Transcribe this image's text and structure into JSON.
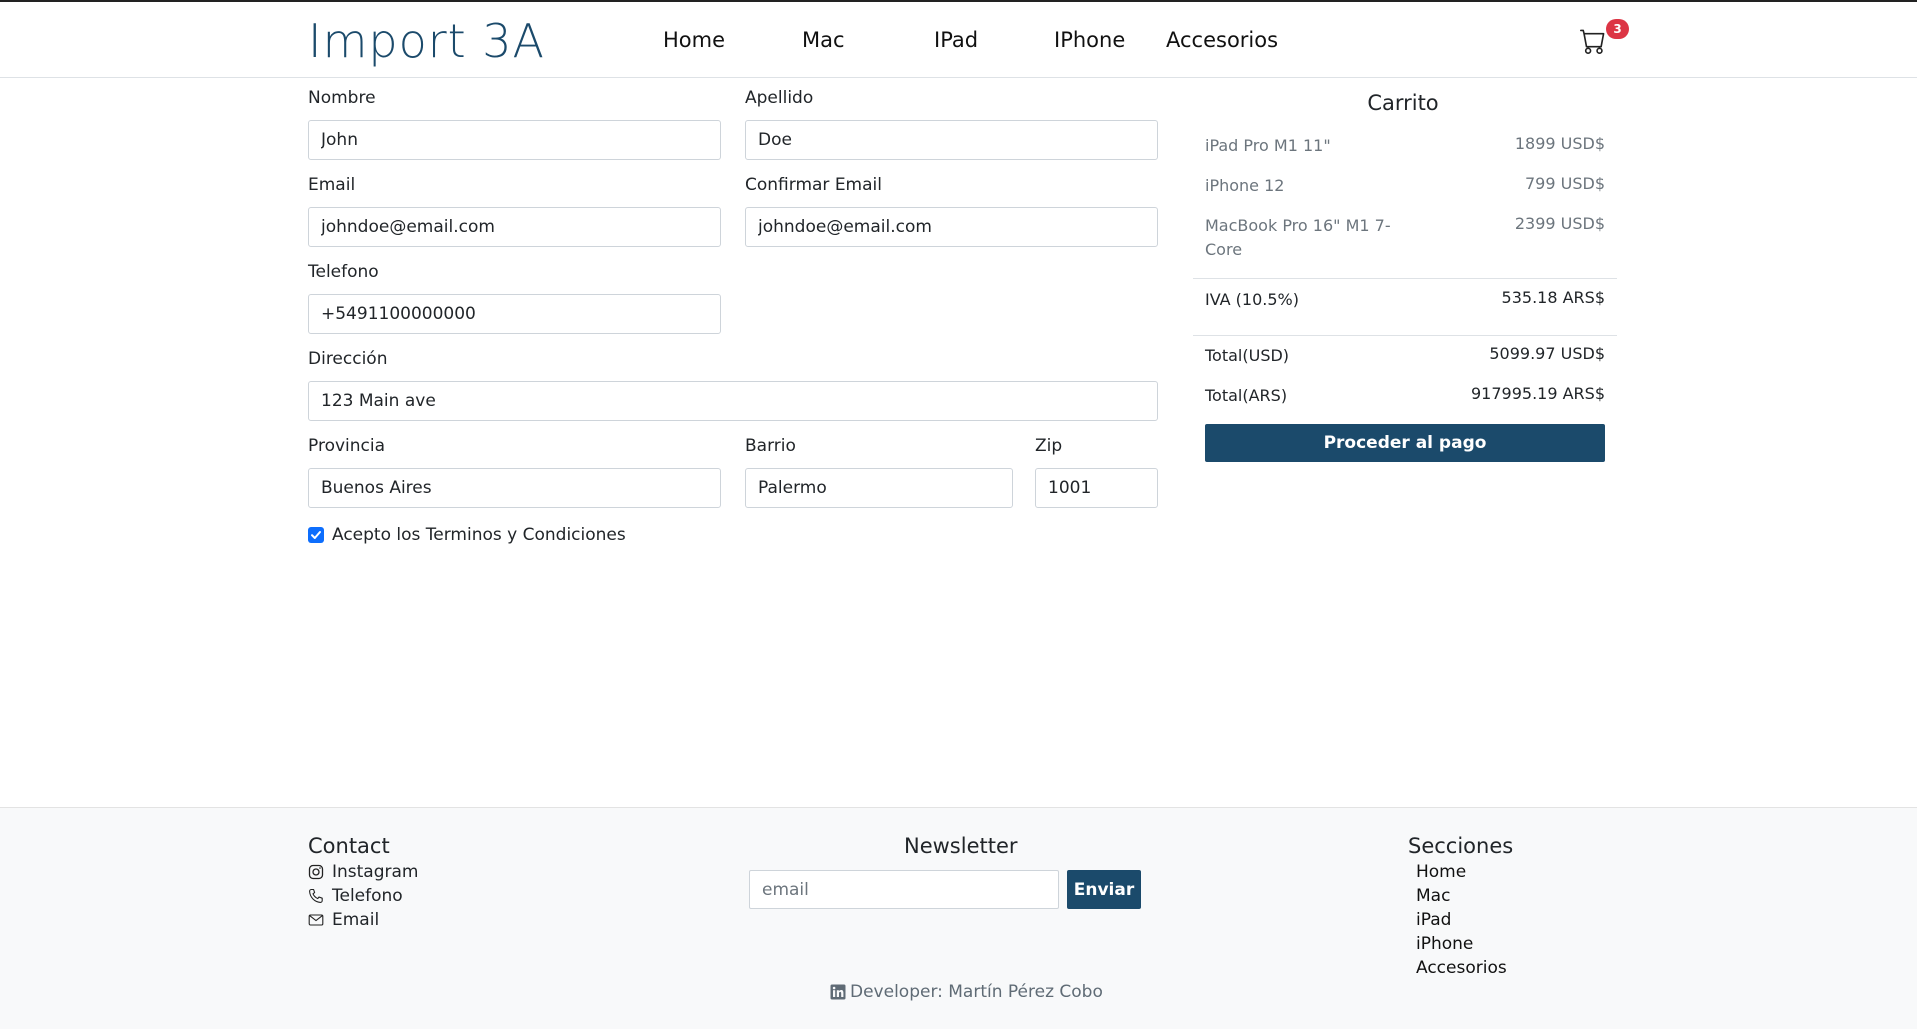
{
  "brand": {
    "logo": "Import 3A"
  },
  "nav": {
    "items": [
      "Home",
      "Mac",
      "IPad",
      "IPhone",
      "Accesorios"
    ],
    "cart_count": "3"
  },
  "form": {
    "nombre": {
      "label": "Nombre",
      "value": "John"
    },
    "apellido": {
      "label": "Apellido",
      "value": "Doe"
    },
    "email": {
      "label": "Email",
      "value": "johndoe@email.com"
    },
    "confirm_email": {
      "label": "Confirmar Email",
      "value": "johndoe@email.com"
    },
    "telefono": {
      "label": "Telefono",
      "value": "+5491100000000"
    },
    "direccion": {
      "label": "Dirección",
      "value": "123 Main ave"
    },
    "provincia": {
      "label": "Provincia",
      "value": "Buenos Aires"
    },
    "barrio": {
      "label": "Barrio",
      "value": "Palermo"
    },
    "zip": {
      "label": "Zip",
      "value": "1001"
    },
    "terms": {
      "label": "Acepto los Terminos y Condiciones",
      "checked": true
    }
  },
  "cart": {
    "title": "Carrito",
    "items": [
      {
        "name": "iPad Pro M1 11\"",
        "price": "1899 USD$"
      },
      {
        "name": "iPhone 12",
        "price": "799 USD$"
      },
      {
        "name": "MacBook Pro 16\" M1 7-Core",
        "price": "2399 USD$"
      }
    ],
    "iva": {
      "label": "IVA (10.5%)",
      "value": "535.18 ARS$"
    },
    "total_usd": {
      "label": "Total(USD)",
      "value": "5099.97 USD$"
    },
    "total_ars": {
      "label": "Total(ARS)",
      "value": "917995.19 ARS$"
    },
    "pay_button": "Proceder al pago"
  },
  "footer": {
    "contact": {
      "title": "Contact",
      "links": [
        {
          "label": "Instagram",
          "icon": "instagram-icon"
        },
        {
          "label": "Telefono",
          "icon": "phone-icon"
        },
        {
          "label": "Email",
          "icon": "envelope-icon"
        }
      ]
    },
    "newsletter": {
      "title": "Newsletter",
      "placeholder": "email",
      "button": "Enviar"
    },
    "sections": {
      "title": "Secciones",
      "links": [
        "Home",
        "Mac",
        "iPad",
        "iPhone",
        "Accesorios"
      ]
    },
    "developer": "Developer: Martín Pérez Cobo"
  },
  "colors": {
    "brand": "#1b4a6b",
    "badge": "#dc3545",
    "checkbox": "#0d6efd"
  }
}
